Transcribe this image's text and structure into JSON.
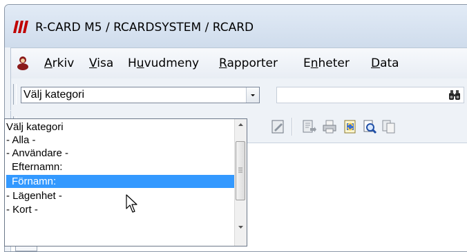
{
  "window": {
    "title": "R-CARD M5 / RCARDSYSTEM / RCARD"
  },
  "menu": {
    "items": [
      {
        "pre": "",
        "u": "A",
        "post": "rkiv"
      },
      {
        "pre": "",
        "u": "V",
        "post": "isa"
      },
      {
        "pre": "H",
        "u": "u",
        "post": "vudmeny"
      },
      {
        "pre": "",
        "u": "R",
        "post": "apporter"
      },
      {
        "pre": "E",
        "u": "n",
        "post": "heter"
      },
      {
        "pre": "",
        "u": "D",
        "post": "ata"
      }
    ]
  },
  "toolbar": {
    "category_combo_value": "Välj kategori",
    "search_value": ""
  },
  "dropdown": {
    "options": [
      "Välj kategori",
      "- Alla -",
      "- Användare -",
      "  Efternamn:",
      "  Förnamn:",
      "- Lägenhet -",
      "- Kort -"
    ],
    "selected_index": 4
  },
  "icons": [
    "app-logo-icon",
    "user-icon",
    "binoculars-icon",
    "edit-icon",
    "export-icon",
    "print-icon",
    "refresh-icon",
    "preview-icon",
    "copy-icon"
  ]
}
